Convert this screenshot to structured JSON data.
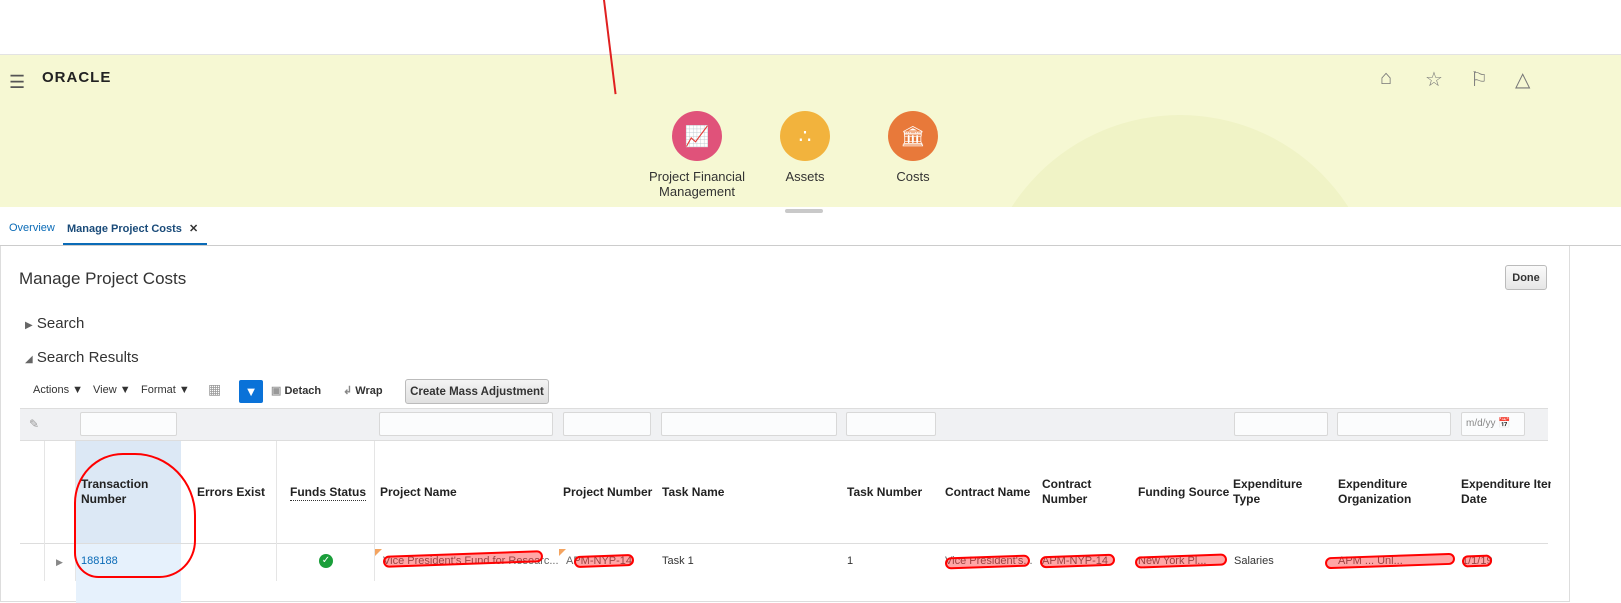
{
  "brand": "ORACLE",
  "apps": [
    {
      "label": "Project Financial Management",
      "color": "#e0527a"
    },
    {
      "label": "Assets",
      "color": "#f2b33d"
    },
    {
      "label": "Costs",
      "color": "#e8793a"
    }
  ],
  "tabs": [
    {
      "label": "Overview"
    },
    {
      "label": "Manage Project Costs"
    }
  ],
  "page_title": "Manage Project Costs",
  "done_label": "Done",
  "search_label": "Search",
  "results_label": "Search Results",
  "toolbar": {
    "actions": "Actions",
    "view": "View",
    "format": "Format",
    "detach": "Detach",
    "wrap": "Wrap",
    "create_mass": "Create Mass Adjustment"
  },
  "date_placeholder": "m/d/yy",
  "columns": [
    "Transaction Number",
    "Errors Exist",
    "Funds Status",
    "Project Name",
    "Project Number",
    "Task Name",
    "Task Number",
    "Contract Name",
    "Contract Number",
    "Funding Source",
    "Expenditure Type",
    "Expenditure Organization",
    "Expenditure Item Date"
  ],
  "row": {
    "transaction_number": "188188",
    "project_name": "Vice President's Fund for Researc...",
    "project_number": "APM-NYP-14",
    "task_name": "Task 1",
    "task_number": "1",
    "contract_name": "Vice President's...",
    "contract_number": "APM-NYP-14",
    "funding_source": "New York Pl...",
    "expenditure_type": "Salaries",
    "expenditure_org": "APM ... Unl...",
    "expenditure_date": "1/1/19"
  }
}
